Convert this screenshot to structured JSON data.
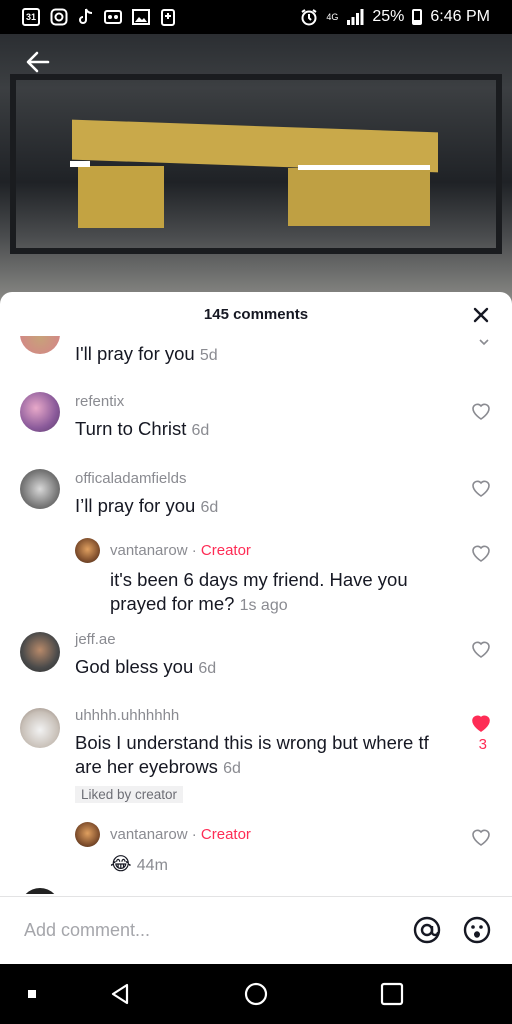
{
  "status": {
    "time": "6:46 PM",
    "battery": "25%",
    "network": "4G",
    "left_icons": [
      "calendar-31-icon",
      "instagram-icon",
      "tiktok-icon",
      "voicemail-icon",
      "gallery-icon",
      "cast-icon"
    ],
    "calendar_day": "31"
  },
  "sheet": {
    "title": "145 comments"
  },
  "comments": [
    {
      "username": "",
      "text": "I'll pray for you",
      "time": "5d"
    },
    {
      "username": "refentix",
      "text": "Turn to Christ",
      "time": "6d"
    },
    {
      "username": "officaladamfields",
      "text": "I’ll pray for you",
      "time": "6d"
    },
    {
      "username": "vantanarow",
      "creator": "Creator",
      "separator": "·",
      "text": "it's been 6 days my friend. Have you prayed for me?",
      "time": "1s ago"
    },
    {
      "username": "jeff.ae",
      "text": "God bless you",
      "time": "6d"
    },
    {
      "username": "uhhhh.uhhhhhh",
      "text": "Bois I understand this is wrong but where tf are her eyebrows",
      "time": "6d",
      "liked_by": "Liked by creator",
      "likes": "3"
    },
    {
      "username": "vantanarow",
      "creator": "Creator",
      "separator": "·",
      "text": "😂",
      "time": "44m"
    }
  ],
  "input": {
    "placeholder": "Add comment..."
  },
  "colors": {
    "accent": "#fe2c55",
    "muted": "#8a8b91",
    "text": "#161823"
  }
}
